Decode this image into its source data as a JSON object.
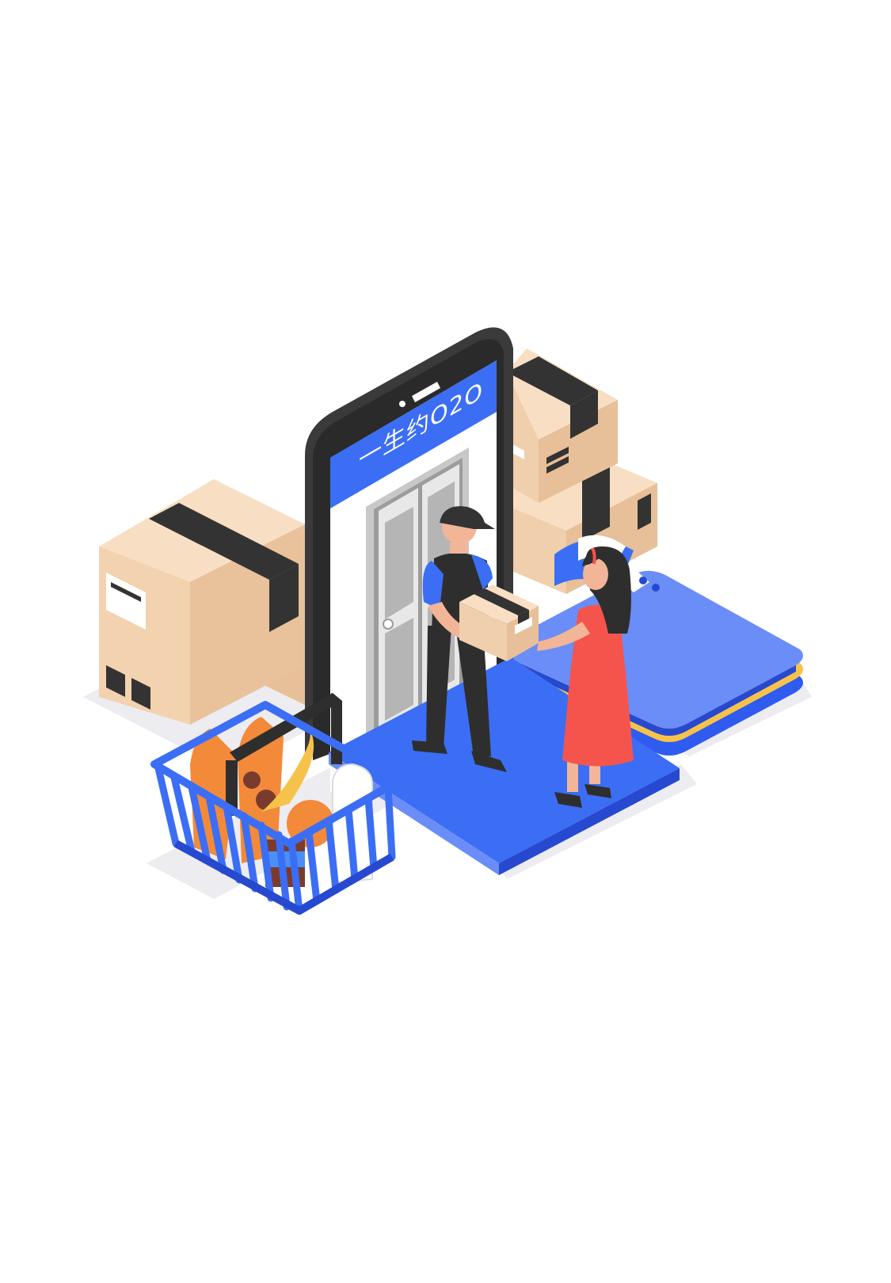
{
  "phone": {
    "screen_title": "一生约O2O"
  },
  "colors": {
    "background": "#ffffff",
    "brand_blue": "#3b6ef5",
    "blue_dark": "#2649d0",
    "blue_light": "#6a8df7",
    "phone_body": "#3a3a3a",
    "cardboard": "#f6d8b7",
    "cardboard_shade": "#e7bf98",
    "tape": "#333333",
    "dress_red": "#f5544d",
    "card_yellow": "#f7c24a",
    "shadow": "#ececf1"
  },
  "icons": [
    "box-icon",
    "basket-icon",
    "smartphone-icon",
    "door-icon",
    "delivery-person-icon",
    "customer-icon",
    "shirt-icon"
  ]
}
